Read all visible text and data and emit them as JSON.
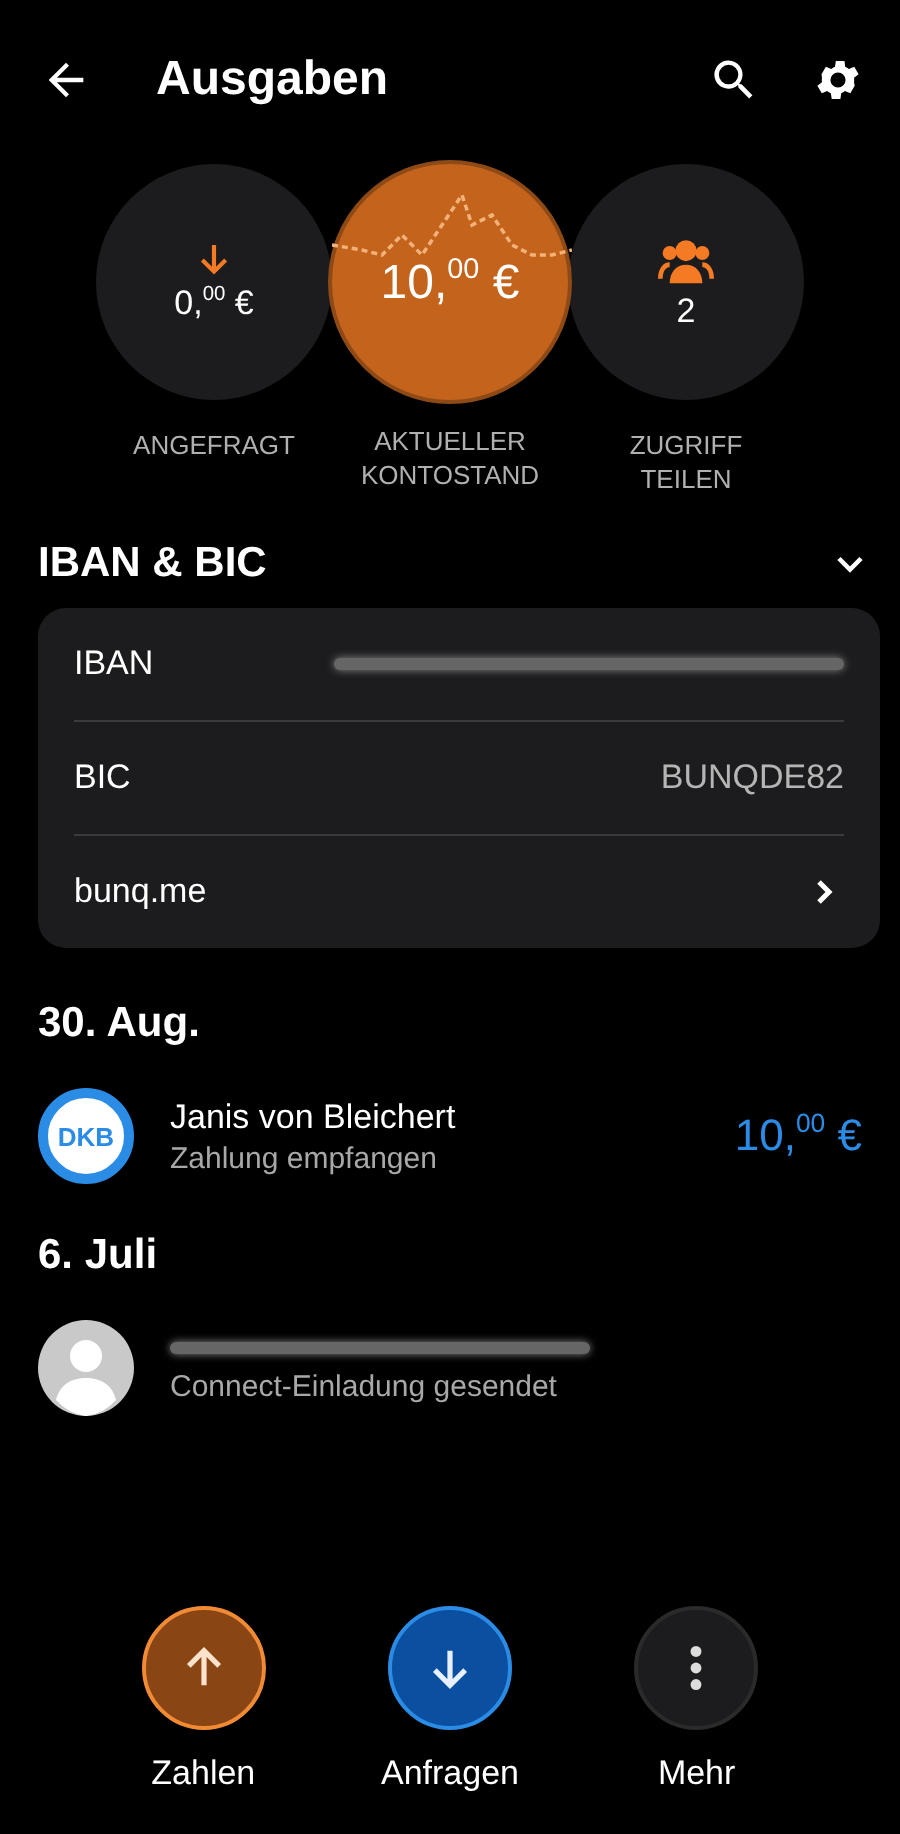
{
  "header": {
    "title": "Ausgaben"
  },
  "summary": [
    {
      "kind": "requested",
      "amount": "0,$^{00}$ €",
      "label": "ANGEFRAGT",
      "highlighted": false
    },
    {
      "kind": "balance",
      "amount": "10,$^{00}$ €",
      "label": "AKTUELLER KONTOSTAND",
      "highlighted": true
    },
    {
      "kind": "share",
      "amount": "2",
      "label": "ZUGRIFF TEILEN",
      "highlighted": false
    }
  ],
  "account_section": {
    "title": "IBAN & BIC",
    "expanded": true,
    "rows": [
      {
        "kind": "redacted",
        "label": "IBAN"
      },
      {
        "kind": "value",
        "label": "BIC",
        "value": "BUNQDE82"
      },
      {
        "kind": "link",
        "label": "bunq.me"
      }
    ]
  },
  "days": [
    {
      "date": "30. Aug.",
      "entries": [
        {
          "kind": "bank",
          "avatar_text": "DKB",
          "name": "Janis von Bleichert",
          "subtitle": "Zahlung empfangen",
          "amount": "10,$^{00}$ €"
        }
      ]
    },
    {
      "date": "6. Juli",
      "entries": [
        {
          "kind": "person",
          "redacted_name": true,
          "subtitle": "Connect-Einladung gesendet"
        }
      ]
    }
  ],
  "actions": [
    {
      "kind": "pay",
      "label": "Zahlen"
    },
    {
      "kind": "request",
      "label": "Anfragen"
    },
    {
      "kind": "more",
      "label": "Mehr"
    }
  ]
}
